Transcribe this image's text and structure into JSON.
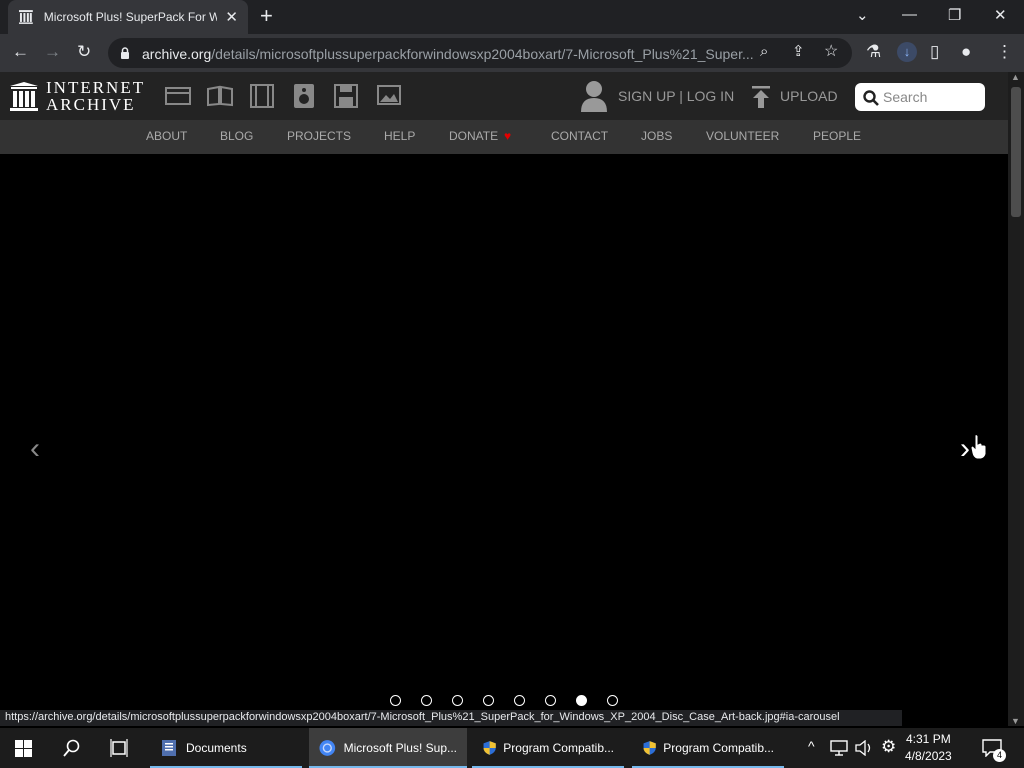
{
  "browser": {
    "tab_title": "Microsoft Plus! SuperPack For Wi",
    "close_glyph": "✕",
    "new_tab_glyph": "+",
    "url_host": "archive.org",
    "url_path": "/details/microsoftplussuperpackforwindowsxp2004boxart/7-Microsoft_Plus%21_Super...",
    "status_url": "https://archive.org/details/microsoftplussuperpackforwindowsxp2004boxart/7-Microsoft_Plus%21_SuperPack_for_Windows_XP_2004_Disc_Case_Art-back.jpg#ia-carousel"
  },
  "ia": {
    "logo_line1": "INTERNET",
    "logo_line2": "ARCHIVE",
    "signup": "SIGN UP | LOG IN",
    "upload": "UPLOAD",
    "search_placeholder": "Search",
    "nav": [
      "ABOUT",
      "BLOG",
      "PROJECTS",
      "HELP",
      "DONATE",
      "CONTACT",
      "JOBS",
      "VOLUNTEER",
      "PEOPLE"
    ],
    "donate_heart": "♥",
    "heart_color": "#e40000"
  },
  "carousel": {
    "prev_glyph": "‹",
    "next_glyph": "›",
    "dot_count": 8,
    "active_dot": 7
  },
  "taskbar": {
    "items": [
      "Documents",
      "Microsoft Plus! Sup...",
      "Program Compatib...",
      "Program Compatib..."
    ],
    "time": "4:31 PM",
    "date": "4/8/2023",
    "notifications": "4",
    "accent": "#76b9ed"
  }
}
